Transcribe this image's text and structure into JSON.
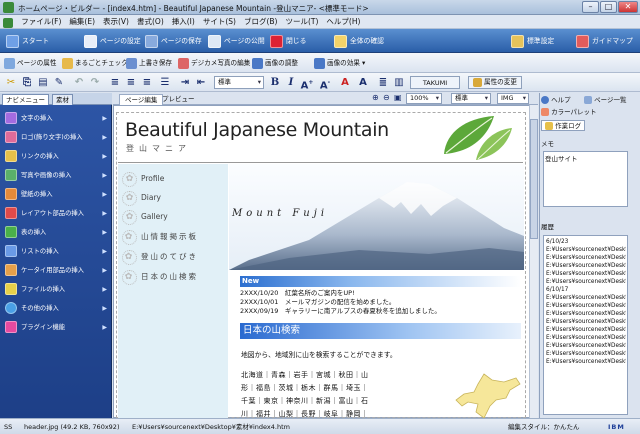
{
  "window": {
    "title": "ホームページ・ビルダー - [index4.htm] - Beautiful Japanese Mountain -登山マニア- <標準モード>"
  },
  "menubar": {
    "items": [
      "ファイル(F)",
      "編集(E)",
      "表示(V)",
      "書式(O)",
      "挿入(I)",
      "サイト(S)",
      "ブログ(B)",
      "ツール(T)",
      "ヘルプ(H)"
    ]
  },
  "bigbar": {
    "start": "スタート",
    "page_settings": "ページの設定",
    "save_page": "ページの保存",
    "publish": "ページの公開",
    "close": "閉じる",
    "check_all": "全体の確認",
    "std_settings": "標準設定",
    "guide_map": "ガイドマップ"
  },
  "lightbar": {
    "page_props": "ページの属性",
    "full_check": "まるごとチェック",
    "overwrite": "上書き保存",
    "photo_edit": "デジカメ写真の編集",
    "adjust_image": "画像の調整",
    "image_effect": "画像の効果"
  },
  "fmtbar": {
    "style": "標準",
    "takumi": "TAKUMI",
    "attr_change": "属性の変更"
  },
  "left": {
    "tabs": [
      "ナビメニュー",
      "素材"
    ],
    "items": [
      "文字の挿入",
      "ロゴ(飾り文字)の挿入",
      "リンクの挿入",
      "写真や画像の挿入",
      "壁紙の挿入",
      "レイアウト部品の挿入",
      "表の挿入",
      "リストの挿入",
      "ケータイ用部品の挿入",
      "ファイルの挿入",
      "その他の挿入",
      "プラグイン機能"
    ]
  },
  "editor": {
    "tabs": [
      "ページ編集",
      "プレビュー"
    ],
    "zoom": "100%",
    "style_sel": "標準",
    "img_sel": "IMG"
  },
  "page": {
    "site_title": "Beautiful Japanese Mountain",
    "site_subtitle": "登山マニア",
    "menu": [
      "Profile",
      "Diary",
      "Gallery",
      "山情報掲示板",
      "登山のてびき",
      "日本の山検索"
    ],
    "mountain_label": "Mount Fuji",
    "news_heading": "New",
    "news": [
      "2XXX/10/20　紅葉名所のご案内をUP!",
      "2XXX/10/01　メールマガジンの配信を始めました。",
      "2XXX/09/19　ギャラリーに南アルプスの春夏秋冬を追加しました。"
    ],
    "section_heading": "日本の山検索",
    "section_desc": "地図から、地域別に山を検索することができます。",
    "prefectures": [
      "北海道｜青森｜岩手｜宮城｜秋田｜山",
      "形｜福島｜茨城｜栃木｜群馬｜埼玉｜",
      "千葉｜東京｜神奈川｜新潟｜富山｜石",
      "川｜福井｜山梨｜長野｜岐阜｜静岡｜"
    ]
  },
  "right": {
    "help": "ヘルプ",
    "page_list": "ページ一覧",
    "color_palette": "カラーパレット",
    "work_log": "作業ログ",
    "memo_label": "メモ",
    "memo_text": "登山サイト",
    "history_label": "履歴",
    "history": [
      "6/10/23",
      "E:¥Users¥sourcenext¥Deskto",
      "E:¥Users¥sourcenext¥Deskto",
      "E:¥Users¥sourcenext¥Deskto",
      "E:¥Users¥sourcenext¥Deskto",
      "E:¥Users¥sourcenext¥Deskto",
      "6/10/17",
      "E:¥Users¥sourcenext¥Deskto",
      "E:¥Users¥sourcenext¥Deskto",
      "E:¥Users¥sourcenext¥Deskto",
      "E:¥Users¥sourcenext¥Deskto",
      "E:¥Users¥sourcenext¥Deskto",
      "E:¥Users¥sourcenext¥Deskto",
      "E:¥Users¥sourcenext¥Deskto",
      "E:¥Users¥sourcenext¥Deskto",
      "E:¥Users¥sourcenext¥Deskto"
    ]
  },
  "status": {
    "mode": "SS",
    "file": "header.jpg (49.2 KB, 760x92)",
    "path": "E:¥Users¥sourcenext¥Desktop¥素材¥index4.htm",
    "edit_style": "編集スタイル：かんたん",
    "brand": "IBM"
  },
  "colors": {
    "accent": "#2a5ea8",
    "nav": "#1d3f87",
    "menu_bg": "#e1f0f7",
    "heading": "#2a6ad0"
  }
}
